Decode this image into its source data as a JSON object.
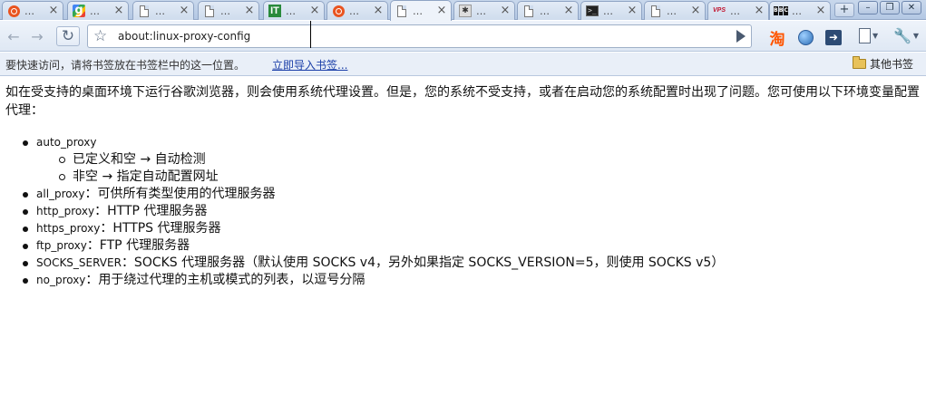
{
  "tabs": [
    {
      "title": "…",
      "favicon": "ubuntu-icon"
    },
    {
      "title": "…",
      "favicon": "google-icon"
    },
    {
      "title": "…",
      "favicon": "document-icon"
    },
    {
      "title": "…",
      "favicon": "document-icon"
    },
    {
      "title": "…",
      "favicon": "it-icon"
    },
    {
      "title": "…",
      "favicon": "ubuntu-icon"
    },
    {
      "title": "…",
      "favicon": "document-icon",
      "active": true
    },
    {
      "title": "…",
      "favicon": "cat-icon"
    },
    {
      "title": "…",
      "favicon": "document-icon"
    },
    {
      "title": "…",
      "favicon": "terminal-icon"
    },
    {
      "title": "…",
      "favicon": "document-icon"
    },
    {
      "title": "…",
      "favicon": "vps-icon",
      "favicon_text": "VPS"
    },
    {
      "title": "…",
      "favicon": "bbc-icon",
      "favicon_text": "BBC"
    }
  ],
  "tab_close": "×",
  "toolbar": {
    "url": "about:linux-proxy-config"
  },
  "bookmarks": {
    "hint": "要快速访问，请将书签放在书签栏中的这一位置。",
    "import_link": "立即导入书签...",
    "other": "其他书签"
  },
  "content": {
    "intro": "如在受支持的桌面环境下运行谷歌浏览器，则会使用系统代理设置。但是，您的系统不受支持，或者在启动您的系统配置时出现了问题。您可使用以下环境变量配置代理：",
    "vars": [
      {
        "name": "auto_proxy",
        "desc": ""
      },
      {
        "name": "all_proxy",
        "desc": "：可供所有类型使用的代理服务器"
      },
      {
        "name": "http_proxy",
        "desc": "：HTTP 代理服务器"
      },
      {
        "name": "https_proxy",
        "desc": "：HTTPS 代理服务器"
      },
      {
        "name": "ftp_proxy",
        "desc": "：FTP 代理服务器"
      },
      {
        "name": "SOCKS_SERVER",
        "desc": "：SOCKS 代理服务器（默认使用 SOCKS v4，另外如果指定 SOCKS_VERSION=5，则使用 SOCKS v5）"
      },
      {
        "name": "no_proxy",
        "desc": "：用于绕过代理的主机或模式的列表，以逗号分隔"
      }
    ],
    "auto_proxy_sub": [
      "已定义和空 → 自动检测",
      "非空 → 指定自动配置网址"
    ]
  }
}
